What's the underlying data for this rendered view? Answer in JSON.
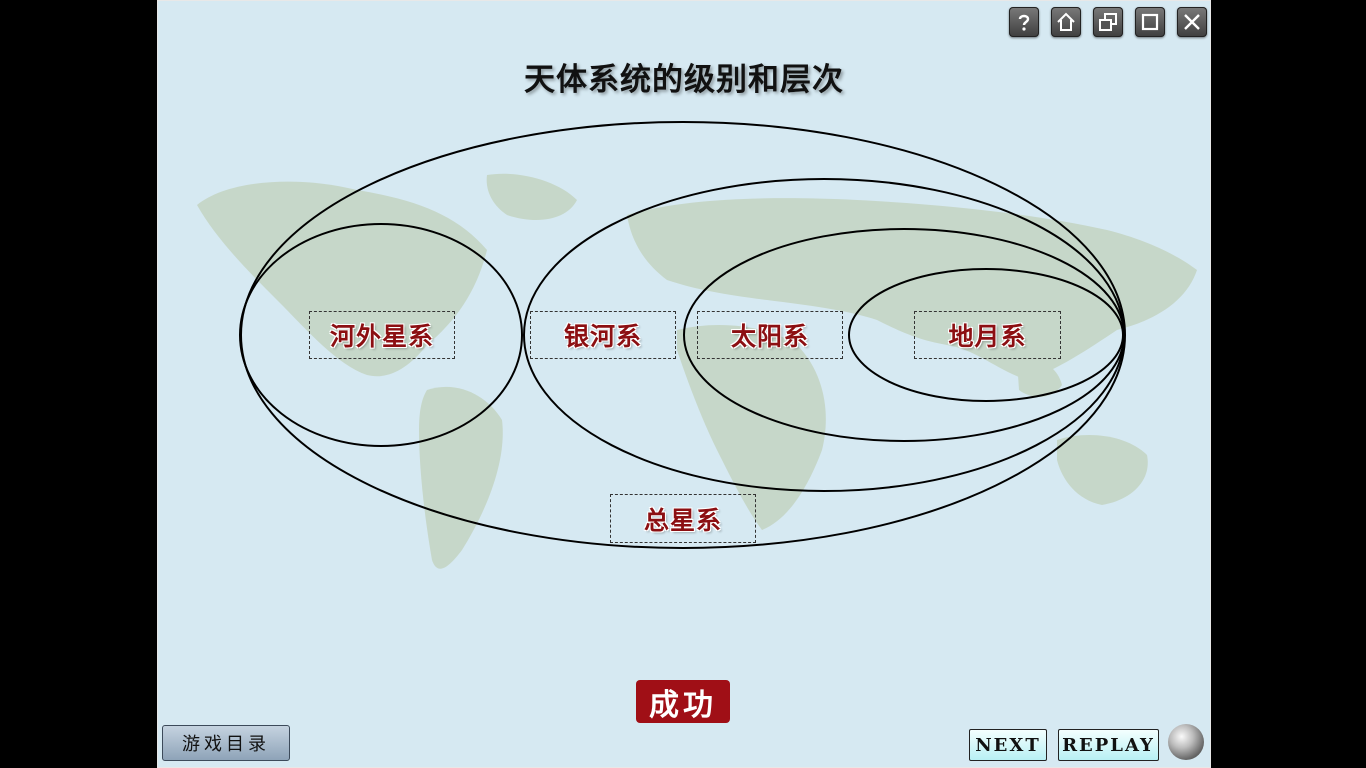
{
  "title": "天体系统的级别和层次",
  "window_controls": [
    {
      "name": "help-button",
      "icon": "question-icon"
    },
    {
      "name": "home-button",
      "icon": "home-icon"
    },
    {
      "name": "restore-button",
      "icon": "restore-icon"
    },
    {
      "name": "maximize-button",
      "icon": "maximize-icon"
    },
    {
      "name": "close-button",
      "icon": "close-icon"
    }
  ],
  "labels": {
    "extragalactic": "河外星系",
    "milky_way": "银河系",
    "solar_system": "太阳系",
    "earth_moon": "地月系",
    "universe": "总星系"
  },
  "success_badge": "成功",
  "menu_button": "游戏目录",
  "next_button": "NEXT",
  "replay_button": "REPLAY",
  "colors": {
    "label_text": "#8c0f12",
    "success_bg": "#a00f16",
    "stage_bg": "#d6e9f2"
  }
}
